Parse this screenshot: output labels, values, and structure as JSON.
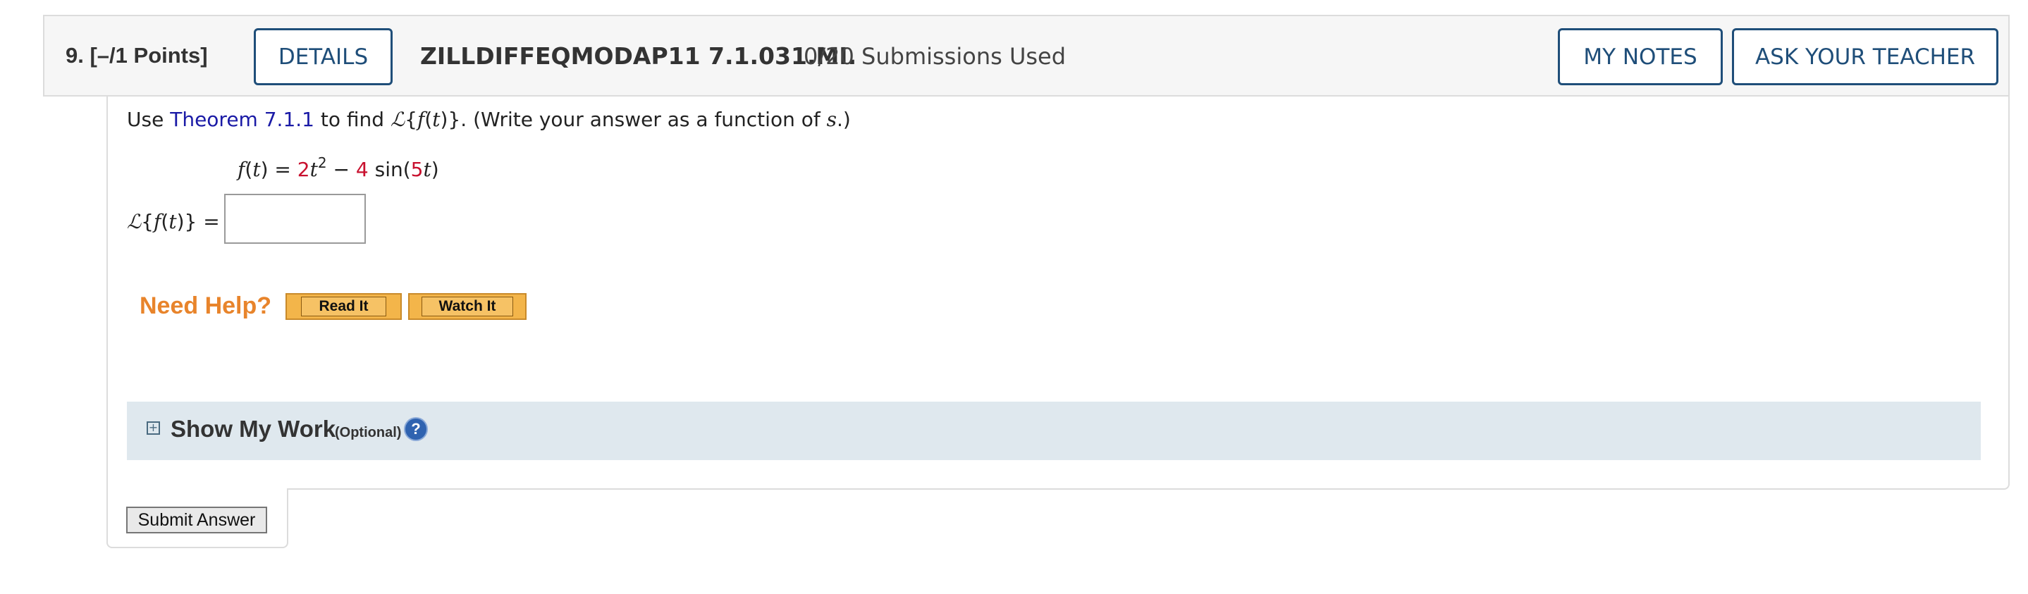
{
  "header": {
    "question_number": "9.",
    "points": "[–/1 Points]",
    "details_label": "DETAILS",
    "question_code": "ZILLDIFFEQMODAP11 7.1.031.MI.",
    "submissions": "0/20 Submissions Used",
    "my_notes_label": "MY NOTES",
    "ask_teacher_label": "ASK YOUR TEACHER"
  },
  "prompt": {
    "use": "Use",
    "theorem_link": "Theorem 7.1.1",
    "to_find": "to find",
    "script_L": "ℒ",
    "lbrace": "{",
    "f": "f",
    "lparen": "(",
    "t": "t",
    "rparen": ")",
    "rbrace_period": "}.",
    "write_instr": "(Write your answer as a function of",
    "s": "s",
    "end": ".)"
  },
  "formula": {
    "lhs_f": "f",
    "lhs_paren_open": "(",
    "lhs_t": "t",
    "lhs_paren_close_eq": ") =",
    "coef1": "2",
    "var1": "t",
    "exp1": "2",
    "minus": "−",
    "coef2": "4",
    "func": "sin(",
    "coef3": "5",
    "var3": "t",
    "close": ")"
  },
  "answer": {
    "label_L": "ℒ",
    "label_brace_open": "{",
    "label_f": "f",
    "label_paren_open": "(",
    "label_t": "t",
    "label_close": ")} =",
    "value": ""
  },
  "help": {
    "need_help": "Need Help?",
    "read_it": "Read It",
    "watch_it": "Watch It"
  },
  "show_my_work": {
    "expand_glyph": "+",
    "title": "Show My Work",
    "optional": "(Optional)",
    "help_glyph": "?"
  },
  "submit": {
    "label": "Submit Answer"
  },
  "colors": {
    "accent_blue": "#1f4e79",
    "link_blue": "#1a1aa6",
    "coef_red": "#c8102e",
    "need_help_orange": "#e8842b"
  }
}
